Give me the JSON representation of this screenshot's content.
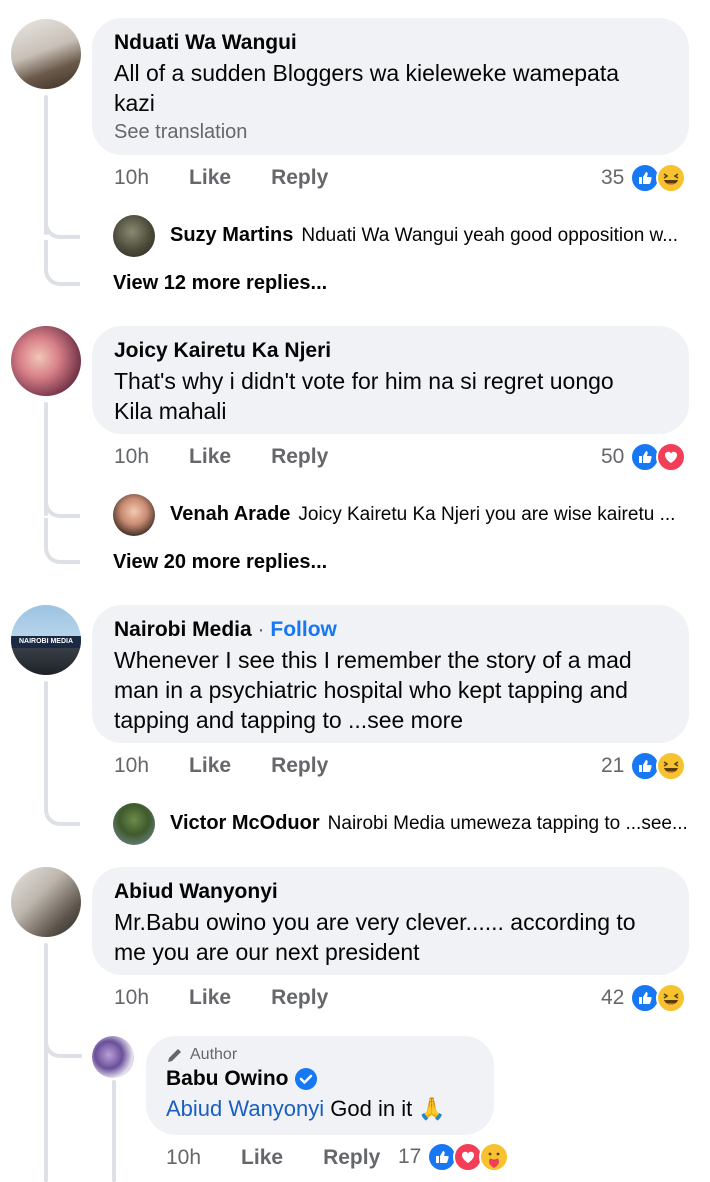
{
  "comments": [
    {
      "name": "Nduati Wa Wangui",
      "text_line1": "All of a sudden Bloggers wa kieleweke wamepata",
      "text_line2": "kazi",
      "see_translation": "See translation",
      "time": "10h",
      "like": "Like",
      "reply": "Reply",
      "reaction_count": "35",
      "reply_preview": {
        "name": "Suzy Martins",
        "text": "Nduati Wa Wangui yeah good opposition w..."
      },
      "view_more": "View 12 more replies..."
    },
    {
      "name": "Joicy Kairetu Ka Njeri",
      "text_line1": "That's why i didn't vote for him na si regret uongo",
      "text_line2": "Kila mahali",
      "time": "10h",
      "like": "Like",
      "reply": "Reply",
      "reaction_count": "50",
      "reply_preview": {
        "name": "Venah Arade",
        "text": "Joicy Kairetu Ka Njeri you are wise kairetu ..."
      },
      "view_more": "View 20 more replies..."
    },
    {
      "name": "Nairobi Media",
      "separator": " · ",
      "follow": "Follow",
      "avatar_text": "NAIROBI MEDIA",
      "text_line1": "Whenever I see this I remember the story of a mad",
      "text_line2": "man in a psychiatric hospital who kept tapping and",
      "text_line3": "tapping and tapping to ...see more",
      "time": "10h",
      "like": "Like",
      "reply": "Reply",
      "reaction_count": "21",
      "reply_preview": {
        "name": "Victor McOduor",
        "text": "Nairobi Media umeweza tapping to ...see..."
      }
    },
    {
      "name": "Abiud Wanyonyi",
      "text_line1": "Mr.Babu owino you are very clever...... according to",
      "text_line2": "me you are our next president",
      "time": "10h",
      "like": "Like",
      "reply": "Reply",
      "reaction_count": "42",
      "author_reply": {
        "tag": "Author",
        "name": "Babu Owino",
        "mention": "Abiud Wanyonyi",
        "text": " God in it 🙏",
        "time": "10h",
        "like": "Like",
        "reply": "Reply",
        "reaction_count": "17"
      }
    }
  ],
  "colors": {
    "like": "#1877f2",
    "love": "#f33e58",
    "haha": "#f7c22f",
    "thread": "#dde0e4",
    "bubble": "#f0f2f5"
  }
}
